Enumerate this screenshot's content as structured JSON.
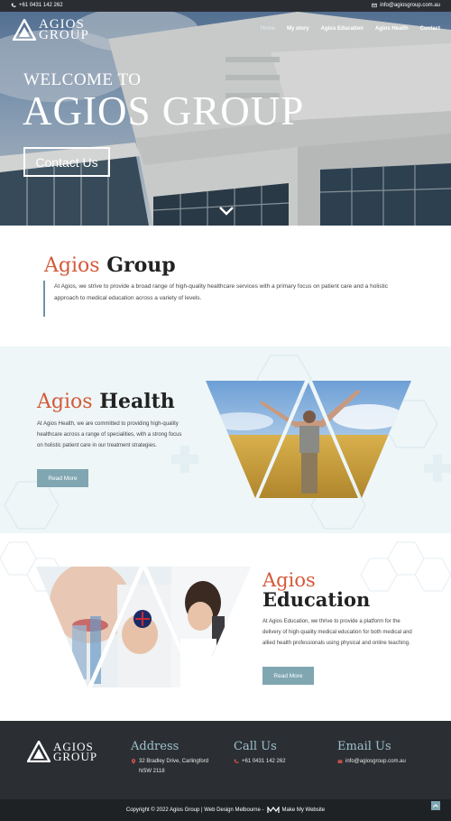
{
  "topbar": {
    "phone": "+61 0431 142 262",
    "email": "info@agiosgroup.com.au"
  },
  "brand": {
    "name_line1": "AGIOS",
    "name_line2": "GROUP"
  },
  "nav": {
    "items": [
      "Home",
      "My story",
      "Agios Education",
      "Agios Health",
      "Contact"
    ],
    "active": "Home"
  },
  "hero": {
    "subtitle": "WELCOME TO",
    "title": "AGIOS GROUP",
    "button": "Contact Us",
    "scroll_icon": "chevron-down-icon"
  },
  "intro": {
    "title_accent": "Agios",
    "title_rest": "Group",
    "text": "At Agios, we strive to provide a broad range of high-quality healthcare services with a primary focus on patient care and a holistic approach to medical education across a variety of levels."
  },
  "health": {
    "title_accent": "Agios",
    "title_rest": "Health",
    "text": "At Agios Health, we are committed to providing high-quality healthcare across a range of specialities, with a strong focus on holistic patient care in our treatment strategies.",
    "button": "Read More"
  },
  "education": {
    "title_accent": "Agios",
    "title_rest": "Education",
    "text": "At Agios Education, we thrive to provide a platform for the delivery of high-quality medical education for both medical and allied health professionals using  physical and online teaching.",
    "button": "Read More"
  },
  "footer": {
    "address_heading": "Address",
    "address_line1": "32 Bradley Drive, Carlingford",
    "address_line2": "NSW 2118",
    "call_heading": "Call Us",
    "phone": "+61 0431 142 262",
    "email_heading": "Email Us",
    "email": "info@agiosgroup.com.au",
    "copyright": "Copyright © 2022 Agios Group | Web Design Melbourne -",
    "credit": "Make My Website"
  },
  "colors": {
    "accent": "#d35a3a",
    "teal": "#7fa6b1",
    "footer": "#2b2f33",
    "heading_blue": "#9ec1cf"
  }
}
